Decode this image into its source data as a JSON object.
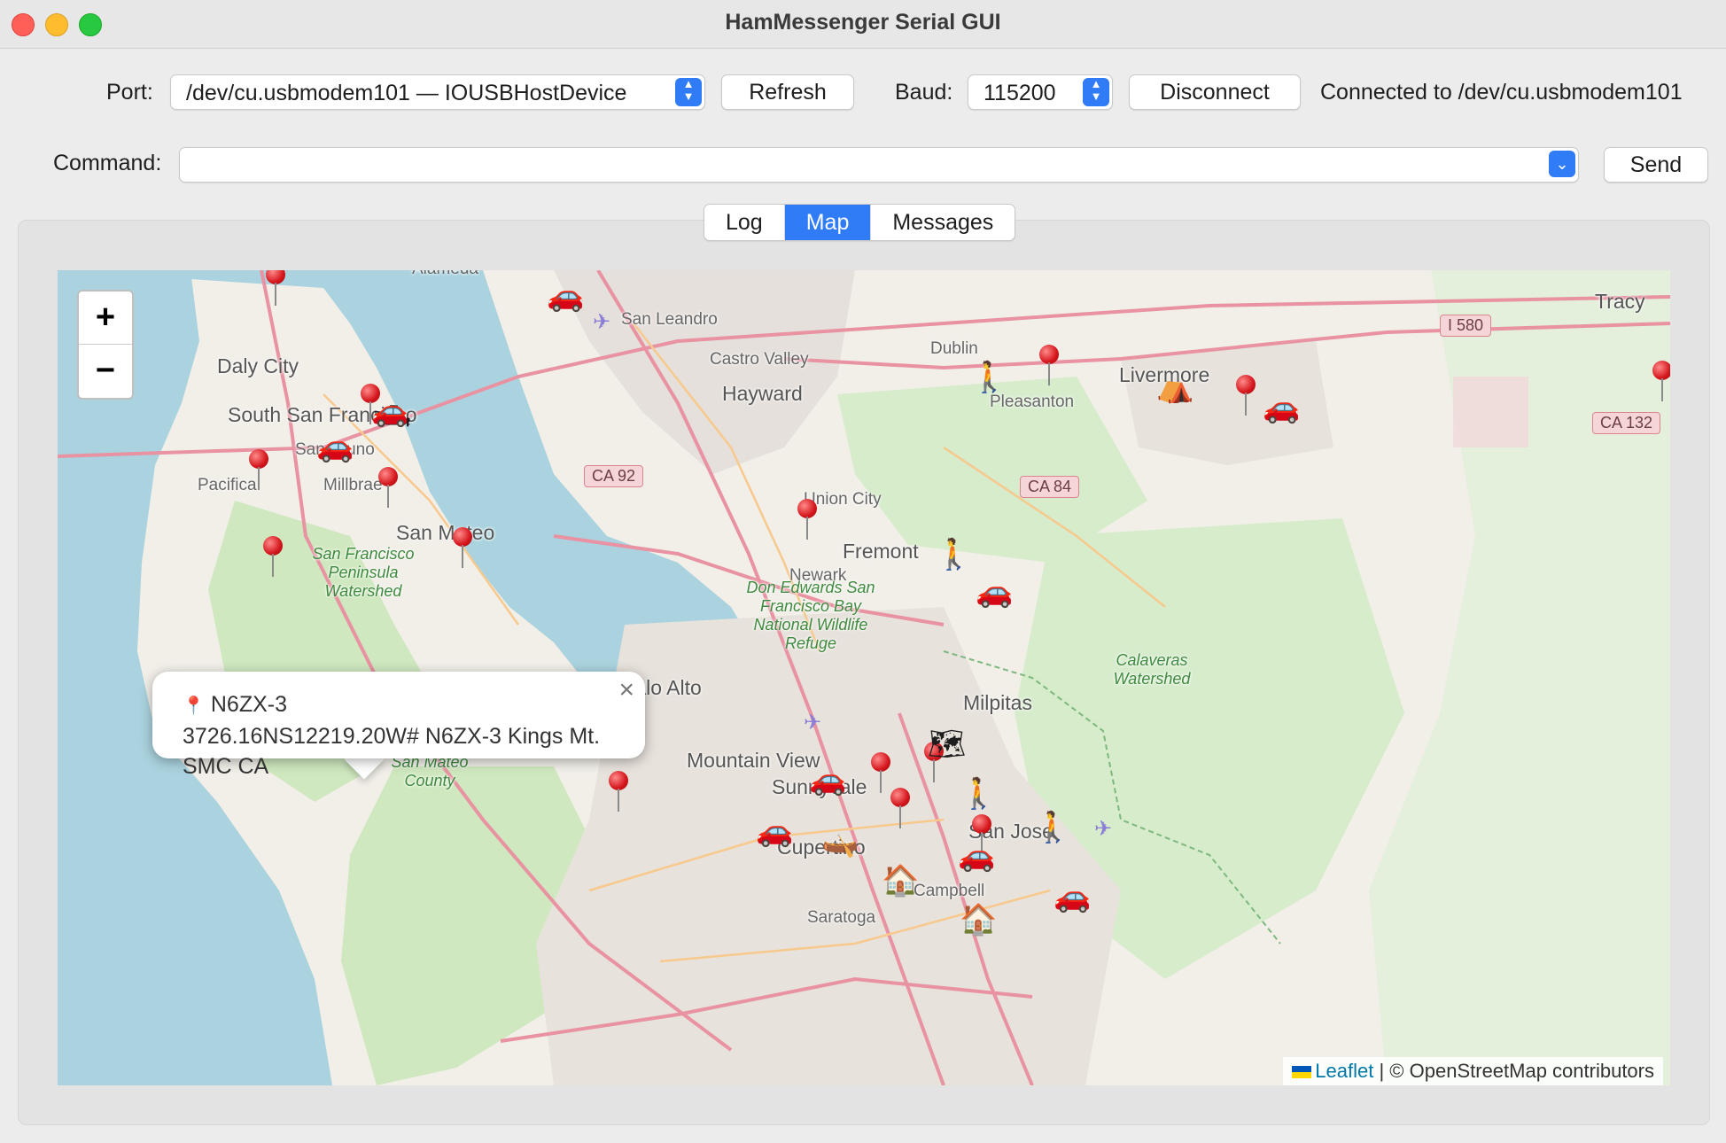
{
  "window": {
    "title": "HamMessenger Serial GUI"
  },
  "port": {
    "label": "Port:",
    "value": "/dev/cu.usbmodem101 — IOUSBHostDevice",
    "refresh_label": "Refresh"
  },
  "baud": {
    "label": "Baud:",
    "value": "115200",
    "disconnect_label": "Disconnect"
  },
  "status": "Connected to /dev/cu.usbmodem101",
  "command": {
    "label": "Command:",
    "value": "",
    "send_label": "Send"
  },
  "tabs": [
    {
      "label": "Log",
      "active": false
    },
    {
      "label": "Map",
      "active": true
    },
    {
      "label": "Messages",
      "active": false
    }
  ],
  "map": {
    "zoom_in": "+",
    "zoom_out": "−",
    "places": {
      "alameda": "Alameda",
      "san_leandro": "San Leandro",
      "daly_city": "Daly City",
      "south_sf": "South San Francisco",
      "castro_valley": "Castro Valley",
      "hayward": "Hayward",
      "dublin": "Dublin",
      "pleasanton": "Pleasanton",
      "livermore": "Livermore",
      "tracy": "Tracy",
      "san_bruno": "San Bruno",
      "pacifica": "Pacifica",
      "millbrae": "Millbrae",
      "san_mateo": "San Mateo",
      "union_city": "Union City",
      "fremont": "Fremont",
      "newark": "Newark",
      "palo_alto": "Palo Alto",
      "milpitas": "Milpitas",
      "mountain_view": "Mountain View",
      "sunnyvale": "Sunnyvale",
      "cupertino": "Cupertino",
      "san_jose": "San Jose",
      "campbell": "Campbell",
      "saratoga": "Saratoga",
      "sf_watershed": "San Francisco Peninsula Watershed",
      "don_edwards": "Don Edwards San Francisco Bay National Wildlife Refuge",
      "calaveras": "Calaveras Watershed",
      "smc": "San Mateo County"
    },
    "shields": {
      "i580": "I 580",
      "ca92": "CA 92",
      "ca84": "CA 84",
      "ca132": "CA 132"
    },
    "popup": {
      "icon": "pin-icon",
      "callsign": "N6ZX-3",
      "detail": "3726.16NS12219.20W# N6ZX-3 Kings Mt. SMC CA",
      "close": "×"
    },
    "attribution": {
      "leaflet": "Leaflet",
      "rest": "| © OpenStreetMap contributors"
    },
    "markers": {
      "car": "🚗",
      "walker": "🚶",
      "camp": "⛺",
      "house": "🏠",
      "boat": "🛥",
      "canoe": "🛶",
      "map": "🗺",
      "plane": "✈"
    }
  }
}
